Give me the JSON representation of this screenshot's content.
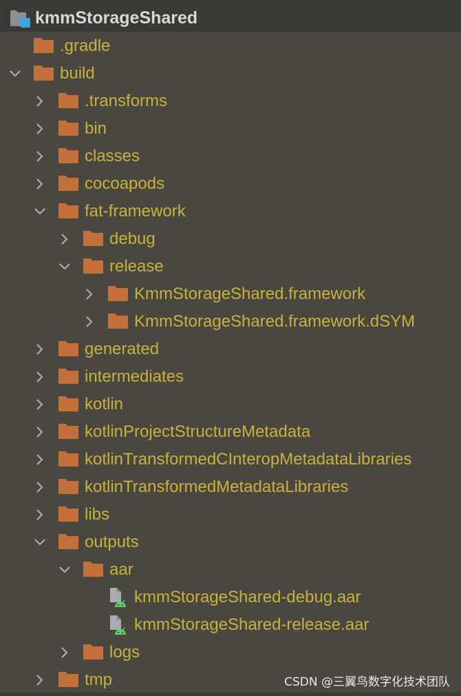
{
  "header": {
    "title": "kmmStorageShared",
    "icon": "module-folder-icon"
  },
  "colors": {
    "background": "#4a4741",
    "header_background": "#3b3936",
    "label_text": "#c7b23e",
    "folder": "#c4703a",
    "chevron": "#b4b4b4",
    "android_green": "#5dce6e"
  },
  "tree": [
    {
      "label": ".gradle",
      "depth": 0,
      "type": "folder",
      "state": "none"
    },
    {
      "label": "build",
      "depth": 0,
      "type": "folder",
      "state": "expanded"
    },
    {
      "label": ".transforms",
      "depth": 1,
      "type": "folder",
      "state": "collapsed"
    },
    {
      "label": "bin",
      "depth": 1,
      "type": "folder",
      "state": "collapsed"
    },
    {
      "label": "classes",
      "depth": 1,
      "type": "folder",
      "state": "collapsed"
    },
    {
      "label": "cocoapods",
      "depth": 1,
      "type": "folder",
      "state": "collapsed"
    },
    {
      "label": "fat-framework",
      "depth": 1,
      "type": "folder",
      "state": "expanded"
    },
    {
      "label": "debug",
      "depth": 2,
      "type": "folder",
      "state": "collapsed"
    },
    {
      "label": "release",
      "depth": 2,
      "type": "folder",
      "state": "expanded"
    },
    {
      "label": "KmmStorageShared.framework",
      "depth": 3,
      "type": "folder",
      "state": "collapsed"
    },
    {
      "label": "KmmStorageShared.framework.dSYM",
      "depth": 3,
      "type": "folder",
      "state": "collapsed"
    },
    {
      "label": "generated",
      "depth": 1,
      "type": "folder",
      "state": "collapsed"
    },
    {
      "label": "intermediates",
      "depth": 1,
      "type": "folder",
      "state": "collapsed"
    },
    {
      "label": "kotlin",
      "depth": 1,
      "type": "folder",
      "state": "collapsed"
    },
    {
      "label": "kotlinProjectStructureMetadata",
      "depth": 1,
      "type": "folder",
      "state": "collapsed"
    },
    {
      "label": "kotlinTransformedCInteropMetadataLibraries",
      "depth": 1,
      "type": "folder",
      "state": "collapsed"
    },
    {
      "label": "kotlinTransformedMetadataLibraries",
      "depth": 1,
      "type": "folder",
      "state": "collapsed"
    },
    {
      "label": "libs",
      "depth": 1,
      "type": "folder",
      "state": "collapsed"
    },
    {
      "label": "outputs",
      "depth": 1,
      "type": "folder",
      "state": "expanded"
    },
    {
      "label": "aar",
      "depth": 2,
      "type": "folder",
      "state": "expanded"
    },
    {
      "label": "kmmStorageShared-debug.aar",
      "depth": 3,
      "type": "aar-file",
      "state": "none"
    },
    {
      "label": "kmmStorageShared-release.aar",
      "depth": 3,
      "type": "aar-file",
      "state": "none"
    },
    {
      "label": "logs",
      "depth": 2,
      "type": "folder",
      "state": "collapsed"
    },
    {
      "label": "tmp",
      "depth": 1,
      "type": "folder",
      "state": "collapsed"
    }
  ],
  "watermark": "CSDN @三翼鸟数字化技术团队"
}
